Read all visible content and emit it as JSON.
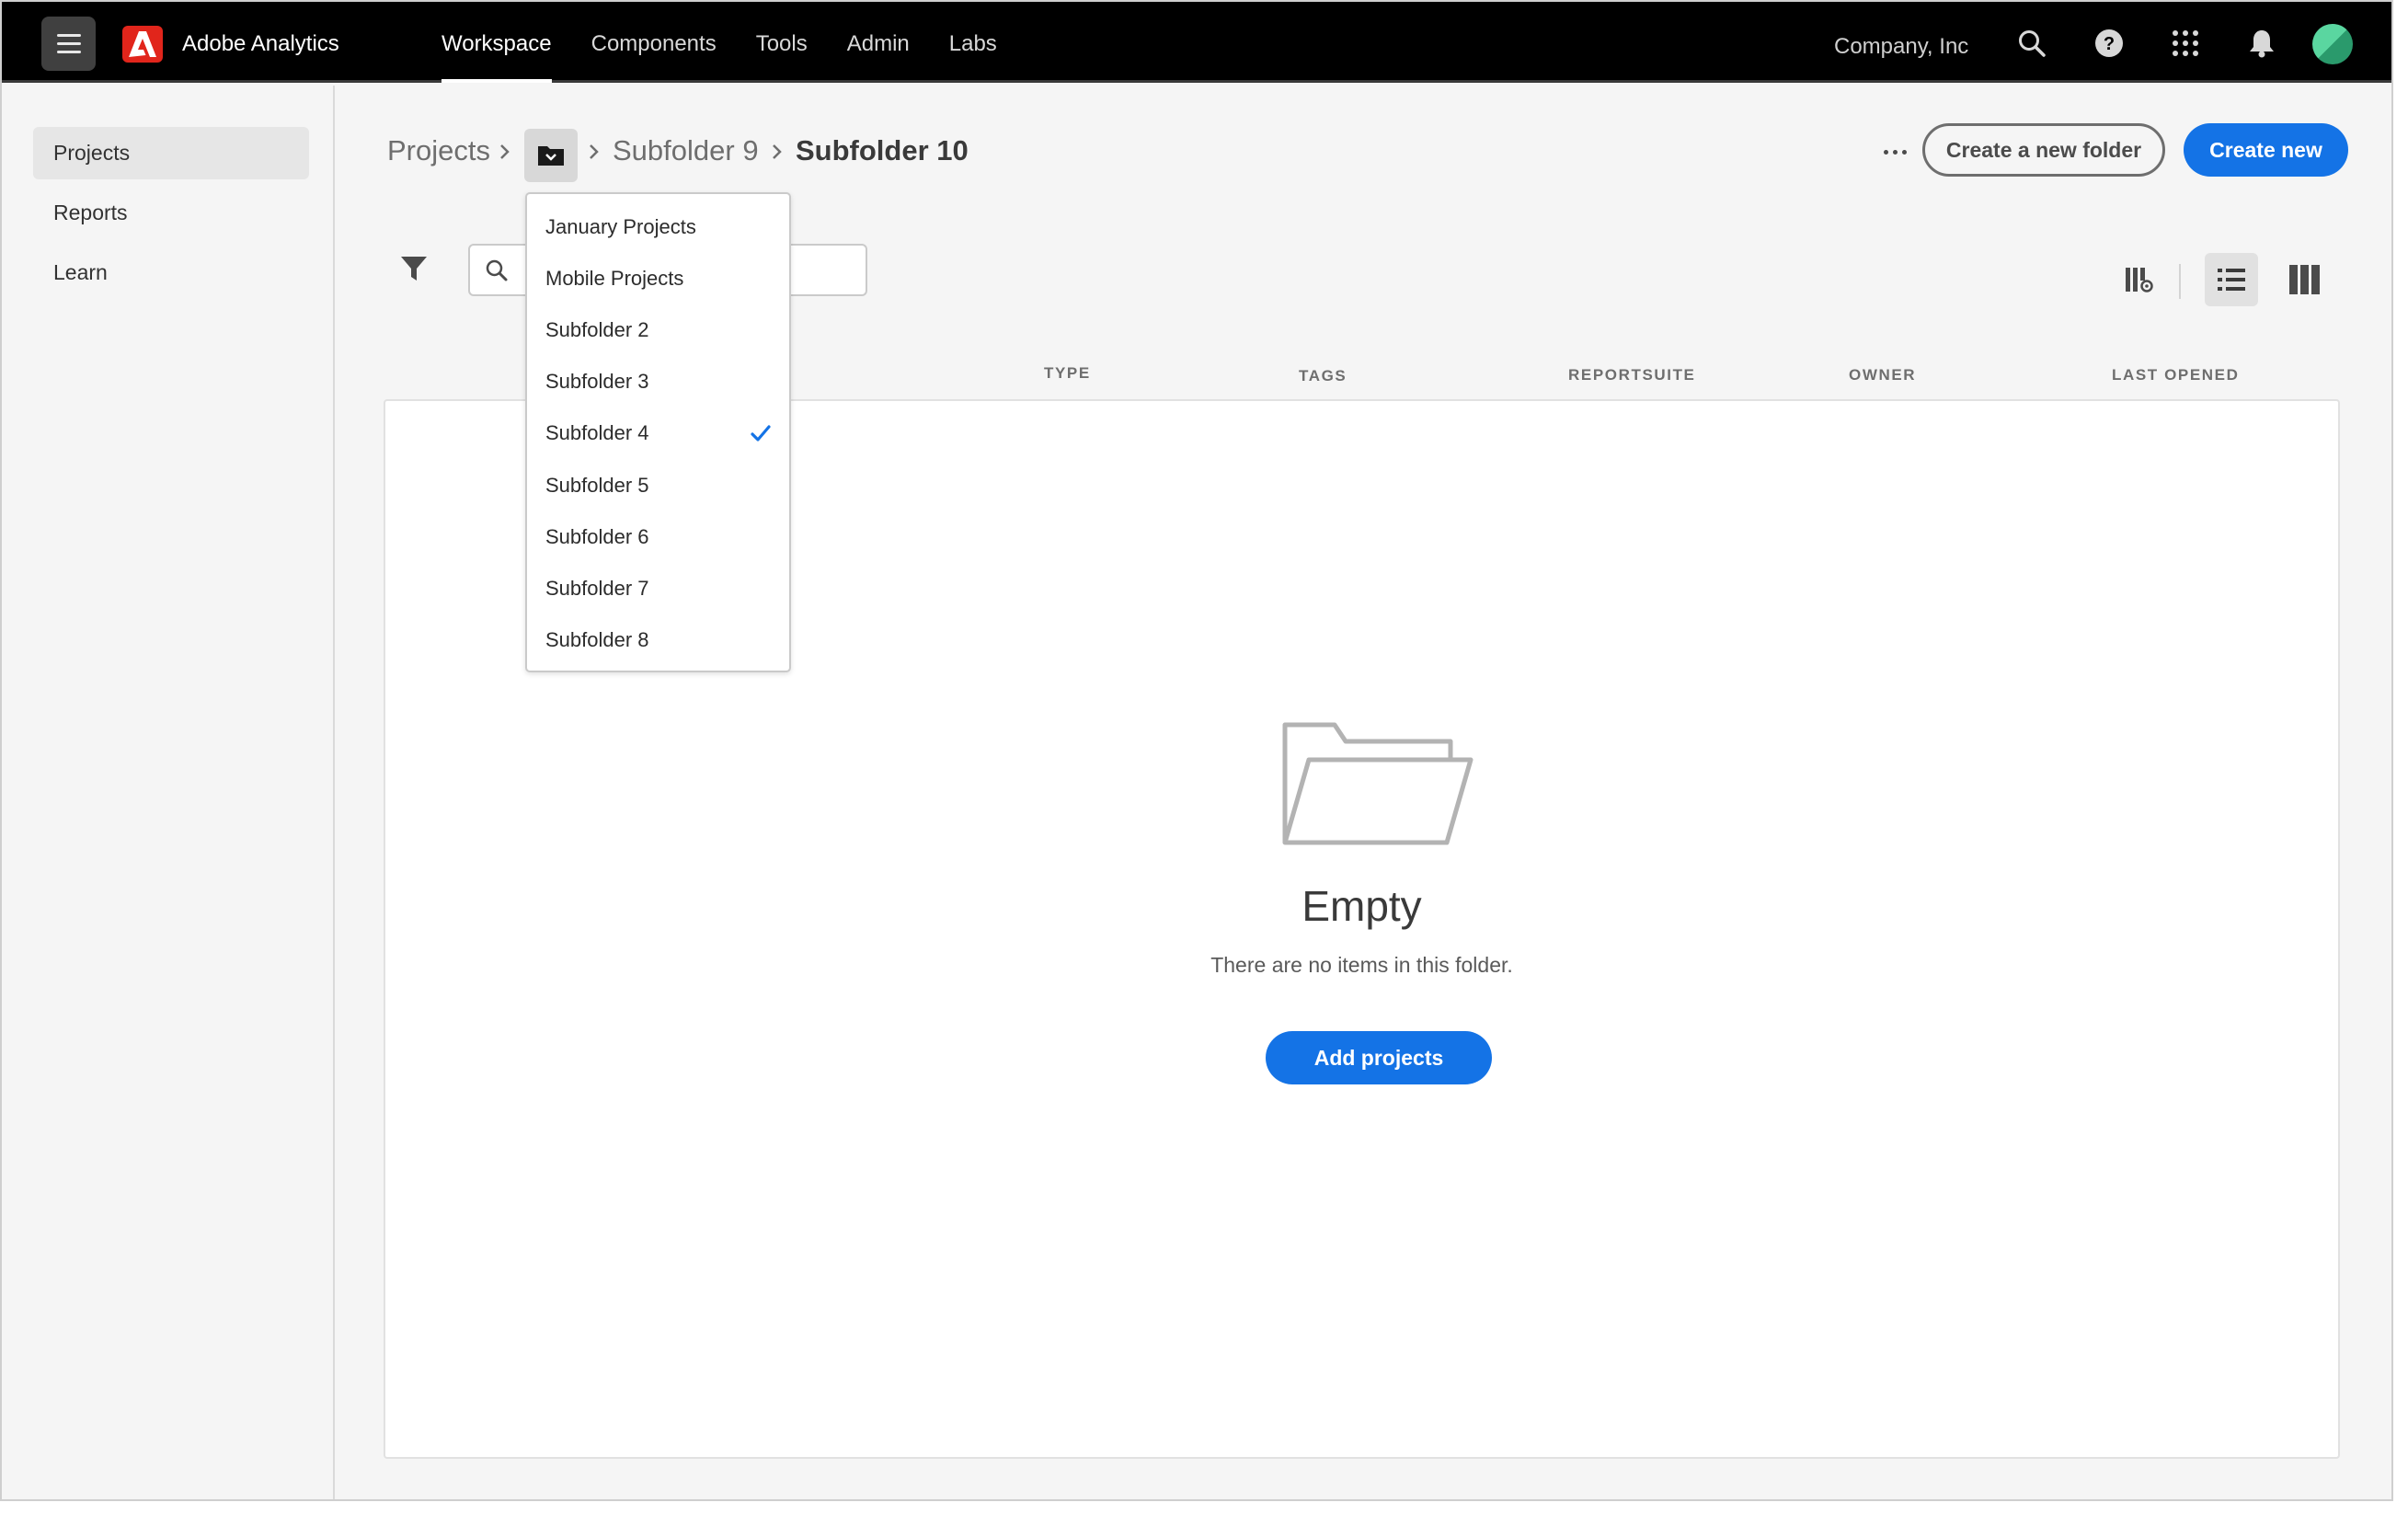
{
  "app": {
    "name": "Adobe Analytics"
  },
  "nav": {
    "items": [
      {
        "label": "Workspace",
        "active": true
      },
      {
        "label": "Components",
        "active": false
      },
      {
        "label": "Tools",
        "active": false
      },
      {
        "label": "Admin",
        "active": false
      },
      {
        "label": "Labs",
        "active": false
      }
    ],
    "org": "Company, Inc",
    "icons": [
      "search-icon",
      "help-icon",
      "apps-grid-icon",
      "bell-icon",
      "avatar"
    ]
  },
  "sidebar": {
    "items": [
      {
        "label": "Projects",
        "active": true
      },
      {
        "label": "Reports",
        "active": false
      },
      {
        "label": "Learn",
        "active": false
      }
    ]
  },
  "breadcrumb": {
    "root": "Projects",
    "parent": "Subfolder 9",
    "current": "Subfolder 10"
  },
  "actions": {
    "create_folder": "Create a new folder",
    "create_new": "Create new"
  },
  "search": {
    "value": "",
    "placeholder": ""
  },
  "columns": [
    "TYPE",
    "TAGS",
    "REPORTSUITE",
    "OWNER",
    "LAST OPENED"
  ],
  "folder_menu": {
    "items": [
      {
        "label": "January Projects",
        "selected": false
      },
      {
        "label": "Mobile Projects",
        "selected": false
      },
      {
        "label": "Subfolder 2",
        "selected": false
      },
      {
        "label": "Subfolder 3",
        "selected": false
      },
      {
        "label": "Subfolder 4",
        "selected": true
      },
      {
        "label": "Subfolder 5",
        "selected": false
      },
      {
        "label": "Subfolder 6",
        "selected": false
      },
      {
        "label": "Subfolder 7",
        "selected": false
      },
      {
        "label": "Subfolder 8",
        "selected": false
      }
    ]
  },
  "empty_state": {
    "title": "Empty",
    "message": "There are no items in this folder.",
    "button": "Add projects"
  },
  "colors": {
    "accent": "#1473e6",
    "brand": "#e1251b",
    "topbar": "#000000"
  }
}
